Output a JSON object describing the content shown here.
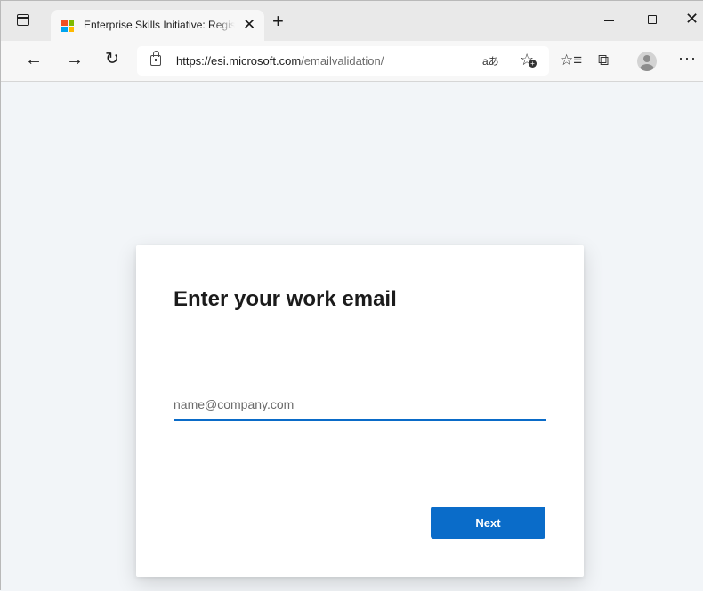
{
  "browser": {
    "tab": {
      "title": "Enterprise Skills Initiative: Registe",
      "close": "✕"
    },
    "new_tab": "+",
    "window": {
      "close": "✕"
    },
    "nav": {
      "back": "←",
      "forward": "→",
      "refresh": "↻"
    },
    "address": {
      "url_host": "https://esi.microsoft.com",
      "url_path": "/emailvalidation/"
    },
    "read_aloud": "aあ",
    "favorite_add": "☆",
    "favorites": "☆≡",
    "collections": "⧉",
    "more": "···"
  },
  "card": {
    "heading": "Enter your work email",
    "email_placeholder": "name@company.com",
    "email_value": "",
    "next_label": "Next"
  },
  "colors": {
    "accent": "#0a6cc9",
    "background": "#f2f5f8",
    "card": "#ffffff"
  }
}
